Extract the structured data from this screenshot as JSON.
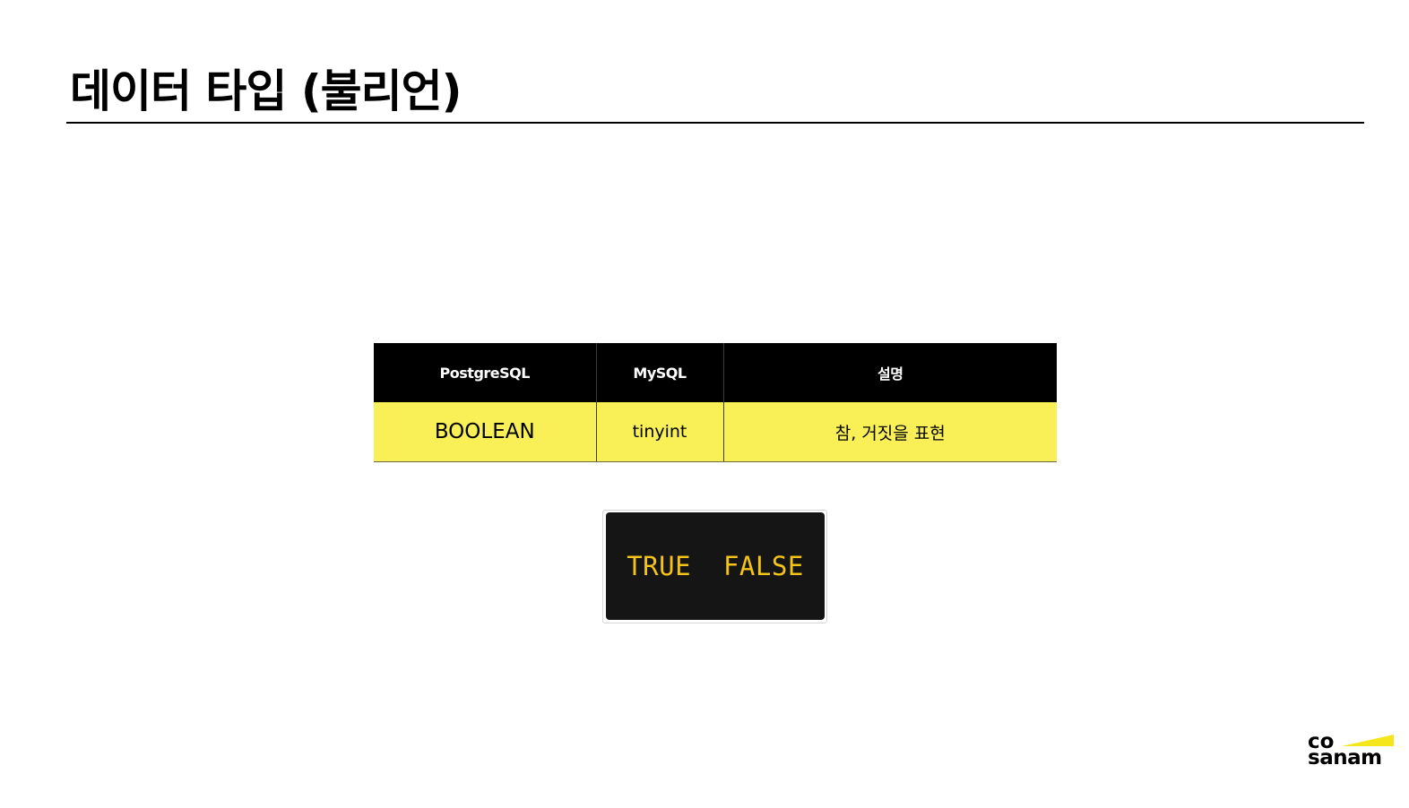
{
  "slide": {
    "title": "데이터 타입 (불리언)"
  },
  "table": {
    "headers": [
      "PostgreSQL",
      "MySQL",
      "설명"
    ],
    "rows": [
      [
        "BOOLEAN",
        "tinyint",
        "참, 거짓을 표현"
      ]
    ]
  },
  "code_example": {
    "text": "TRUE  FALSE"
  },
  "logo": {
    "line1": "co",
    "line2": "sanam"
  },
  "colors": {
    "accent_yellow": "#f8f056",
    "code_background": "#151515",
    "code_text": "#f3c319",
    "logo_wedge": "#f5e51b"
  }
}
